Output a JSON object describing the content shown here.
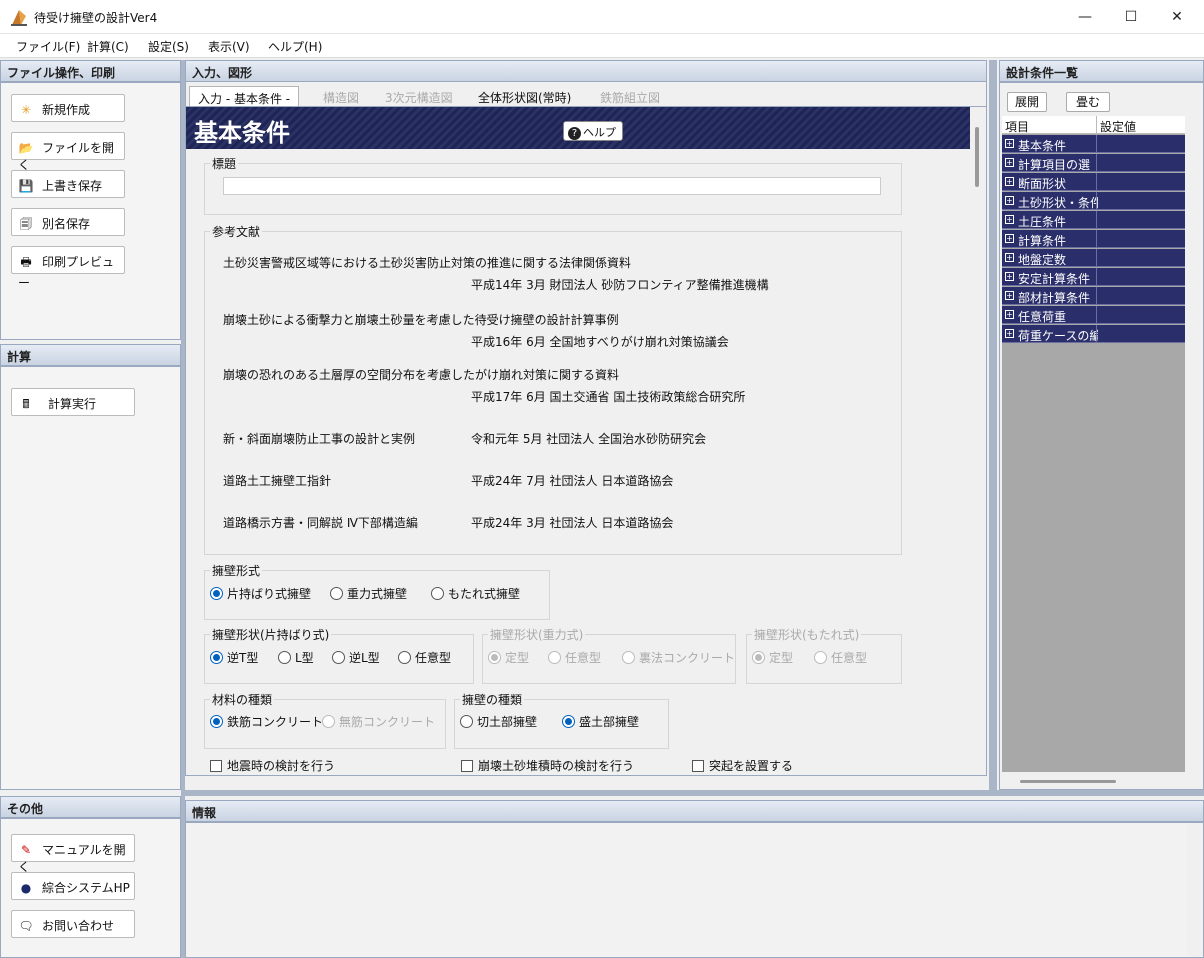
{
  "window": {
    "title": "待受け擁壁の設計Ver4",
    "min": "—",
    "max": "☐",
    "close": "✕"
  },
  "menu": [
    "ファイル(F)",
    "計算(C)",
    "設定(S)",
    "表示(V)",
    "ヘルプ(H)"
  ],
  "left": {
    "file_title": "ファイル操作、印刷",
    "file_buttons": [
      "新規作成",
      "ファイルを開く",
      "上書き保存",
      "別名保存",
      "印刷プレビュー"
    ],
    "calc_title": "計算",
    "calc_button": "計算実行",
    "other_title": "その他",
    "other_buttons": [
      "マニュアルを開く",
      "綜合システムHP",
      "お問い合わせ"
    ]
  },
  "center": {
    "title": "入力、図形",
    "tabs": [
      "入力 - 基本条件 -",
      "構造図",
      "3次元構造図",
      "全体形状図(常時)",
      "鉄筋組立図"
    ],
    "banner": "基本条件",
    "help": "ヘルプ",
    "title_group": "標題",
    "title_value": "",
    "ref_group": "参考文献",
    "refs": [
      {
        "title": "土砂災害警戒区域等における土砂災害防止対策の推進に関する法律関係資料",
        "meta": "平成14年  3月  財団法人  砂防フロンティア整備推進機構"
      },
      {
        "title": "崩壊土砂による衝撃力と崩壊土砂量を考慮した待受け擁壁の設計計算事例",
        "meta": "平成16年  6月  全国地すべりがけ崩れ対策協議会"
      },
      {
        "title": "崩壊の恐れのある土層厚の空間分布を考慮したがけ崩れ対策に関する資料",
        "meta": "平成17年  6月  国土交通省  国土技術政策総合研究所"
      },
      {
        "title": "新・斜面崩壊防止工事の設計と実例",
        "meta": "令和元年  5月  社団法人  全国治水砂防研究会"
      },
      {
        "title": "道路土工擁壁工指針",
        "meta": "平成24年  7月  社団法人  日本道路協会"
      },
      {
        "title": "道路橋示方書・同解説  Ⅳ下部構造編",
        "meta": "平成24年  3月  社団法人  日本道路協会"
      }
    ],
    "wall_type": {
      "label": "擁壁形式",
      "options": [
        "片持ばり式擁壁",
        "重力式擁壁",
        "もたれ式擁壁"
      ],
      "selected": 0
    },
    "shape_cant": {
      "label": "擁壁形状(片持ばり式)",
      "options": [
        "逆T型",
        "L型",
        "逆L型",
        "任意型"
      ],
      "selected": 0
    },
    "shape_grav": {
      "label": "擁壁形状(重力式)",
      "options": [
        "定型",
        "任意型",
        "裏法コンクリート"
      ],
      "selected": 0
    },
    "shape_lean": {
      "label": "擁壁形状(もたれ式)",
      "options": [
        "定型",
        "任意型"
      ],
      "selected": 0
    },
    "material": {
      "label": "材料の種類",
      "options": [
        "鉄筋コンクリート",
        "無筋コンクリート"
      ],
      "selected": 0
    },
    "wall_kind": {
      "label": "擁壁の種類",
      "options": [
        "切土部擁壁",
        "盛土部擁壁"
      ],
      "selected": 1
    },
    "checks": [
      "地震時の検討を行う",
      "崩壊土砂堆積時の検討を行う",
      "突起を設置する"
    ]
  },
  "info": {
    "title": "情報"
  },
  "right": {
    "title": "設計条件一覧",
    "expand": "展開",
    "collapse": "畳む",
    "col_item": "項目",
    "col_value": "設定値",
    "items": [
      "基本条件",
      "計算項目の選",
      "断面形状",
      "土砂形状・条件",
      "土圧条件",
      "計算条件",
      "地盤定数",
      "安定計算条件",
      "部材計算条件",
      "任意荷重",
      "荷重ケースの編"
    ]
  }
}
